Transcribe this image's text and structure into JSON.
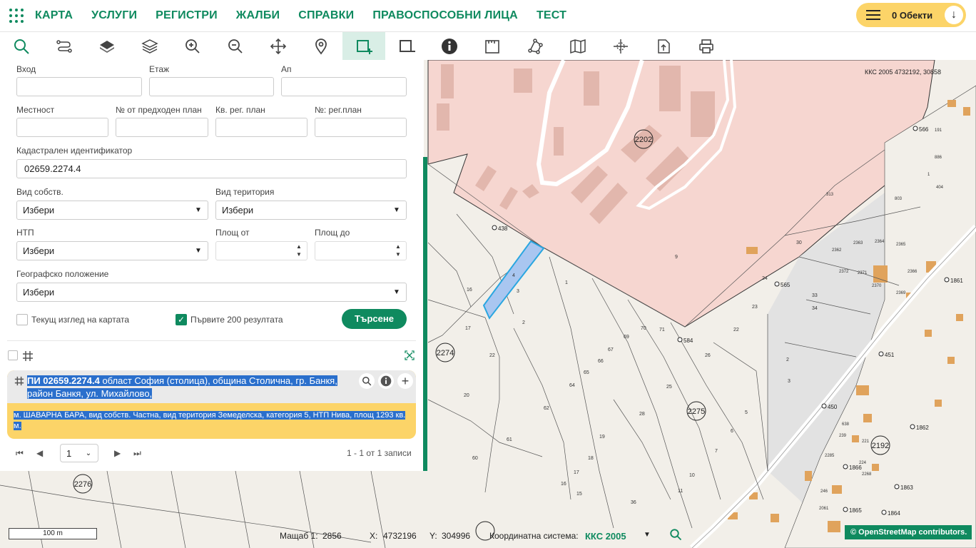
{
  "topnav": {
    "items": [
      "КАРТА",
      "УСЛУГИ",
      "РЕГИСТРИ",
      "ЖАЛБИ",
      "СПРАВКИ",
      "ПРАВОСПОСОБНИ ЛИЦА",
      "ТЕСТ"
    ],
    "objects_label": "0 Обекти"
  },
  "toolbar": {
    "tools": [
      "search-tool",
      "route-tool",
      "layer-tool",
      "layers-tool",
      "zoom-in-tool",
      "zoom-out-tool",
      "pan-tool",
      "location-tool",
      "select-rect-tool",
      "select-rect-remove-tool",
      "info-tool",
      "measure-tool",
      "polygon-tool",
      "map-tool",
      "coords-tool",
      "export-tool",
      "print-tool"
    ],
    "active": "select-rect-tool"
  },
  "form": {
    "entrance_label": "Вход",
    "floor_label": "Етаж",
    "apartment_label": "Ап",
    "locality_label": "Местност",
    "prev_plan_no_label": "№ от предходен план",
    "block_reg_plan_label": "Кв. рег. план",
    "reg_plan_no_label": "№: рег.план",
    "cadastral_id_label": "Кадастрален идентификатор",
    "cadastral_id_value": "02659.2274.4",
    "ownership_label": "Вид собств.",
    "ownership_value": "Избери",
    "territory_label": "Вид територия",
    "territory_value": "Избери",
    "ntp_label": "НТП",
    "ntp_value": "Избери",
    "area_from_label": "Площ от",
    "area_to_label": "Площ до",
    "geo_label": "Географско положение",
    "geo_value": "Избери",
    "current_view_label": "Текущ изглед на картата",
    "first200_label": "Първите 200 резултата",
    "search_button": "Търсене"
  },
  "result": {
    "title_bold": "ПИ 02659.2274.4",
    "title_rest": " област София (столица), община Столична, гр. Банкя, район Банкя, ул. Михайлово,",
    "description": "м. ШАВАРНА БАРА, вид собств. Частна, вид територия Земеделска, категория 5, НТП Нива, площ 1293 кв. м."
  },
  "pager": {
    "page": "1",
    "summary": "1 - 1 от 1 записи"
  },
  "statusbar": {
    "scale_bar": "100 m",
    "scale_label": "Мащаб 1:",
    "scale_value": "2856",
    "x_label": "X:",
    "x_value": "4732196",
    "y_label": "Y:",
    "y_value": "304996",
    "crs_label": "Координатна система:",
    "crs_value": "ККС 2005",
    "attribution": "© OpenStreetMap contributors."
  },
  "map": {
    "coord_readout": "ККС 2005 4732192, 30858",
    "parcel_labels": [
      "2202",
      "2274",
      "2275",
      "2276",
      "2192"
    ],
    "point_labels": [
      "438",
      "584",
      "565",
      "566",
      "1861",
      "451",
      "450",
      "1862",
      "1866",
      "1863",
      "1865",
      "1864"
    ],
    "colors": {
      "accent": "#0f8a5f",
      "yellow": "#fcd468",
      "zone_pink": "#f6d6d0",
      "selected_parcel": "#a9c6f0"
    }
  }
}
